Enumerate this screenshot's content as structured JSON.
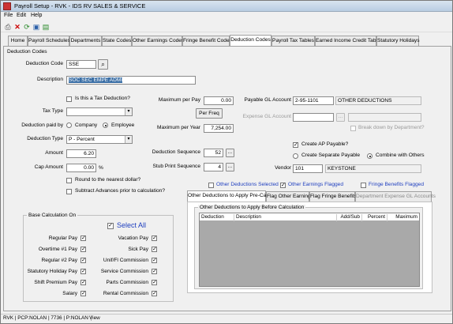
{
  "window": {
    "title": "Payroll Setup - RVK - IDS RV SALES & SERVICE"
  },
  "menu": {
    "file": "File",
    "edit": "Edit",
    "help": "Help"
  },
  "toolbar": {
    "icons": [
      "print-icon",
      "delete-icon",
      "refresh-icon",
      "save-icon",
      "export-icon"
    ]
  },
  "tabs": [
    "Home",
    "Payroll Schedules",
    "Departments",
    "State Codes",
    "Other Earnings Codes",
    "Fringe Benefit Codes",
    "Deduction Codes",
    "Payroll Tax Tables",
    "Earned Income Credit Table",
    "Statutory Holidays"
  ],
  "group_title": "Deduction Codes",
  "form": {
    "deduction_code_label": "Deduction Code",
    "deduction_code": "SSE",
    "description_label": "Description",
    "description": "SOC SEC EMPE ADMI",
    "tax_deduction_label": "Is this a Tax Deduction?",
    "tax_type_label": "Tax Type",
    "tax_type": "",
    "paid_by_label": "Deduction paid by",
    "company_label": "Company",
    "employee_label": "Employee",
    "deduction_type_label": "Deduction Type",
    "deduction_type": "P - Percent",
    "amount_label": "Amount",
    "amount": "6.20",
    "cap_amount_label": "Cap Amount",
    "cap_amount": "0.00",
    "cap_unit": "%",
    "round_label": "Round to the nearest dollar?",
    "subtract_label": "Subtract Advances prior to calculation?",
    "max_per_pay_label": "Maximum per Pay",
    "max_per_pay": "0.00",
    "per_freq_label": "Per Freq",
    "max_per_year_label": "Maximum per Year",
    "max_per_year": "7,254.00",
    "deduction_sequence_label": "Deduction Sequence",
    "deduction_sequence": "52",
    "stub_print_label": "Stub Print Sequence",
    "stub_print": "4",
    "ellipsis": "...",
    "payable_gl_label": "Payable GL Account",
    "payable_gl": "2-95-1101",
    "payable_gl_desc": "OTHER DEDUCTIONS",
    "expense_gl_label": "Expense GL Account",
    "break_down_label": "Break down by Department?",
    "create_ap_label": "Create AP Payable?",
    "create_separate_label": "Create Separate Payable",
    "combine_label": "Combine with Others",
    "vendor_label": "Vendor",
    "vendor_code": "101",
    "vendor_name": "KEYSTONE"
  },
  "flags": {
    "other_deductions": "Other Deductions Selected",
    "other_earnings": "Other Earnings Flagged",
    "fringe_benefits": "Fringe Benefits Flagged"
  },
  "subtabs": [
    "Other Deductions to Apply Pre-Calc",
    "Flag Other Earnings",
    "Flag Fringe Benefits",
    "Department Expense GL Accounts"
  ],
  "subpanel_title": "Other Deductions to Apply Before Calculation",
  "grid_columns": [
    "Deduction",
    "Description",
    "Add/Sub",
    "Percent",
    "Maximum"
  ],
  "base_calc": {
    "title": "Base Calculation On",
    "select_all": "Select All",
    "left": [
      "Regular Pay",
      "Overtime #1 Pay",
      "Regular #2 Pay",
      "Statutory Holiday Pay",
      "Shift Premium Pay",
      "Salary"
    ],
    "right": [
      "Vacation Pay",
      "Sick Pay",
      "Unif/Fl Commission",
      "Service Commission",
      "Parts Commission",
      "Rental Commission"
    ]
  },
  "status": {
    "left": "RVK | PCP:NOLAN | 7736 | P:NOLAN",
    "view": "View"
  },
  "colors": {
    "selection": "#3a6ea5",
    "flag_text": "#1f3fbf",
    "grid_body": "#a9a9a9"
  }
}
